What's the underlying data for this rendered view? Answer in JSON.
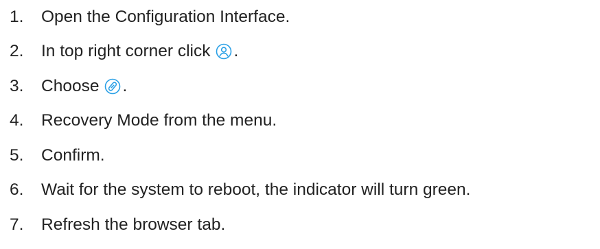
{
  "steps": [
    {
      "number": "1.",
      "text": "Open the Configuration Interface."
    },
    {
      "number": "2.",
      "text_before": "In top right corner click",
      "icon": "user-circle-icon",
      "text_after": "."
    },
    {
      "number": "3.",
      "text_before": "Choose",
      "icon": "link-circle-icon",
      "text_after": "."
    },
    {
      "number": "4.",
      "text": "Recovery Mode from the menu."
    },
    {
      "number": "5.",
      "text": "Confirm."
    },
    {
      "number": "6.",
      "text": "Wait for the system to reboot, the indicator will turn green."
    },
    {
      "number": "7.",
      "text": "Refresh the browser tab."
    }
  ],
  "colors": {
    "text": "#222222",
    "icon_accent": "#2aa0e6"
  }
}
